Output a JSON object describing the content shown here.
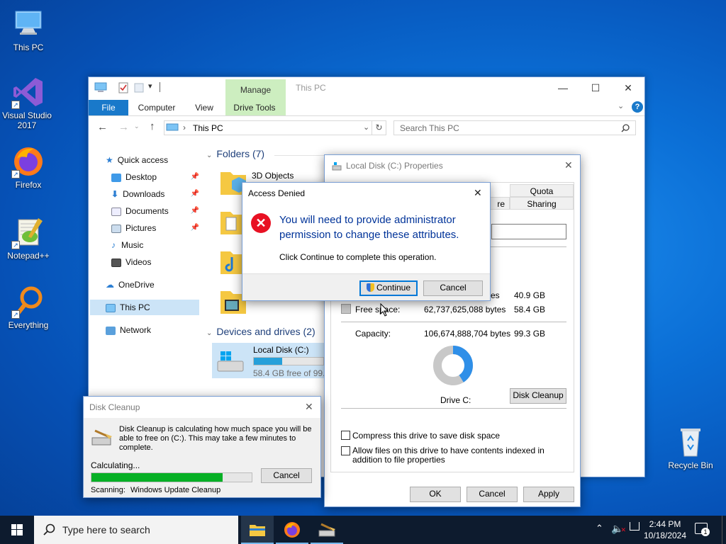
{
  "desktop": {
    "icons": [
      {
        "label": "This PC"
      },
      {
        "label": "Visual Studio 2017"
      },
      {
        "label": "Firefox"
      },
      {
        "label": "Notepad++"
      },
      {
        "label": "Everything"
      },
      {
        "label": "Recycle Bin"
      }
    ]
  },
  "explorer": {
    "title": "This PC",
    "contextual_tab": "Manage",
    "tabs": [
      "File",
      "Computer",
      "View",
      "Drive Tools"
    ],
    "address": "This PC",
    "search_placeholder": "Search This PC",
    "nav": [
      "Quick access",
      "Desktop",
      "Downloads",
      "Documents",
      "Pictures",
      "Music",
      "Videos",
      "OneDrive",
      "This PC",
      "Network"
    ],
    "folders_header": "Folders (7)",
    "folders": [
      "3D Objects"
    ],
    "devices_header": "Devices and drives (2)",
    "drive": {
      "name": "Local Disk (C:)",
      "free_text": "58.4 GB free of 99.3",
      "used_fraction": 0.41
    }
  },
  "properties": {
    "title": "Local Disk (C:) Properties",
    "tabs": [
      "Quota",
      "re",
      "Sharing"
    ],
    "used_bytes": "es",
    "used_gb": "40.9 GB",
    "free_label": "Free space:",
    "free_bytes": "62,737,625,088 bytes",
    "free_gb": "58.4 GB",
    "capacity_label": "Capacity:",
    "capacity_bytes": "106,674,888,704 bytes",
    "capacity_gb": "99.3 GB",
    "drive_label": "Drive C:",
    "cleanup_btn": "Disk Cleanup",
    "compress": "Compress this drive to save disk space",
    "index": "Allow files on this drive to have contents indexed in addition to file properties",
    "ok": "OK",
    "cancel": "Cancel",
    "apply": "Apply",
    "used_fraction": 0.41,
    "colors": {
      "used": "#2f8fe8",
      "free": "#c8c8c8"
    }
  },
  "access_denied": {
    "title": "Access Denied",
    "heading": "You will need to provide administrator permission to change these attributes.",
    "body": "Click Continue to complete this operation.",
    "continue": "Continue",
    "cancel": "Cancel"
  },
  "disk_cleanup": {
    "title": "Disk Cleanup",
    "message": "Disk Cleanup is calculating how much space you will be able to free on  (C:). This may take a few minutes to complete.",
    "status": "Calculating...",
    "progress": 0.82,
    "cancel": "Cancel",
    "scanning_label": "Scanning:",
    "scanning_item": "Windows Update Cleanup"
  },
  "taskbar": {
    "search_placeholder": "Type here to search",
    "time": "2:44 PM",
    "date": "10/18/2024",
    "notifications": "1"
  }
}
